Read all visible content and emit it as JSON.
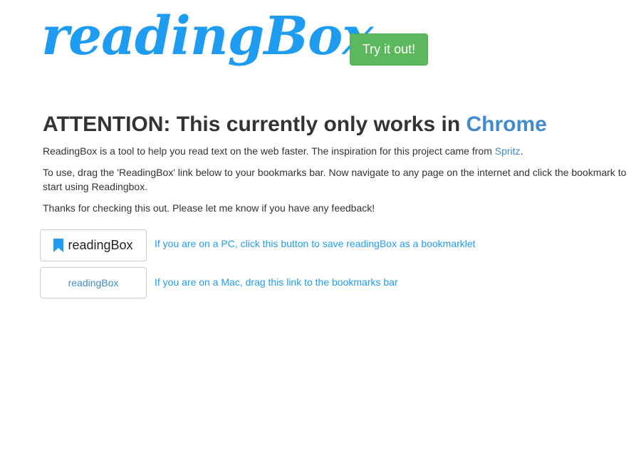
{
  "header": {
    "logo_text": "readingBox",
    "try_button_label": "Try it out!"
  },
  "notice": {
    "heading_prefix": "ATTENTION: This currently only works in ",
    "heading_link": "Chrome"
  },
  "intro": {
    "p1_text": "ReadingBox is a tool to help you read text on the web faster. The inspiration for this project came from ",
    "p1_link": "Spritz",
    "p1_suffix": ".",
    "p2_text": "To use, drag the 'ReadingBox' link below to your bookmarks bar. Now navigate to any page on the internet and click the bookmark to start using Readingbox.",
    "p3_text": "Thanks for checking this out. Please let me know if you have any feedback!"
  },
  "bookmarklets": {
    "pc_button_label": "readingBox",
    "pc_hint": "If you are on a PC, click this button to save readingBox as a bookmarklet",
    "mac_link_label": "readingBox",
    "mac_hint": "If you are on a Mac, drag this link to the bookmarks bar",
    "bookmark_icon": "bookmark-icon"
  },
  "colors": {
    "brand_blue": "#1e9cf2",
    "link_blue": "#428bca",
    "success_green": "#5cb85c",
    "text": "#333333"
  }
}
